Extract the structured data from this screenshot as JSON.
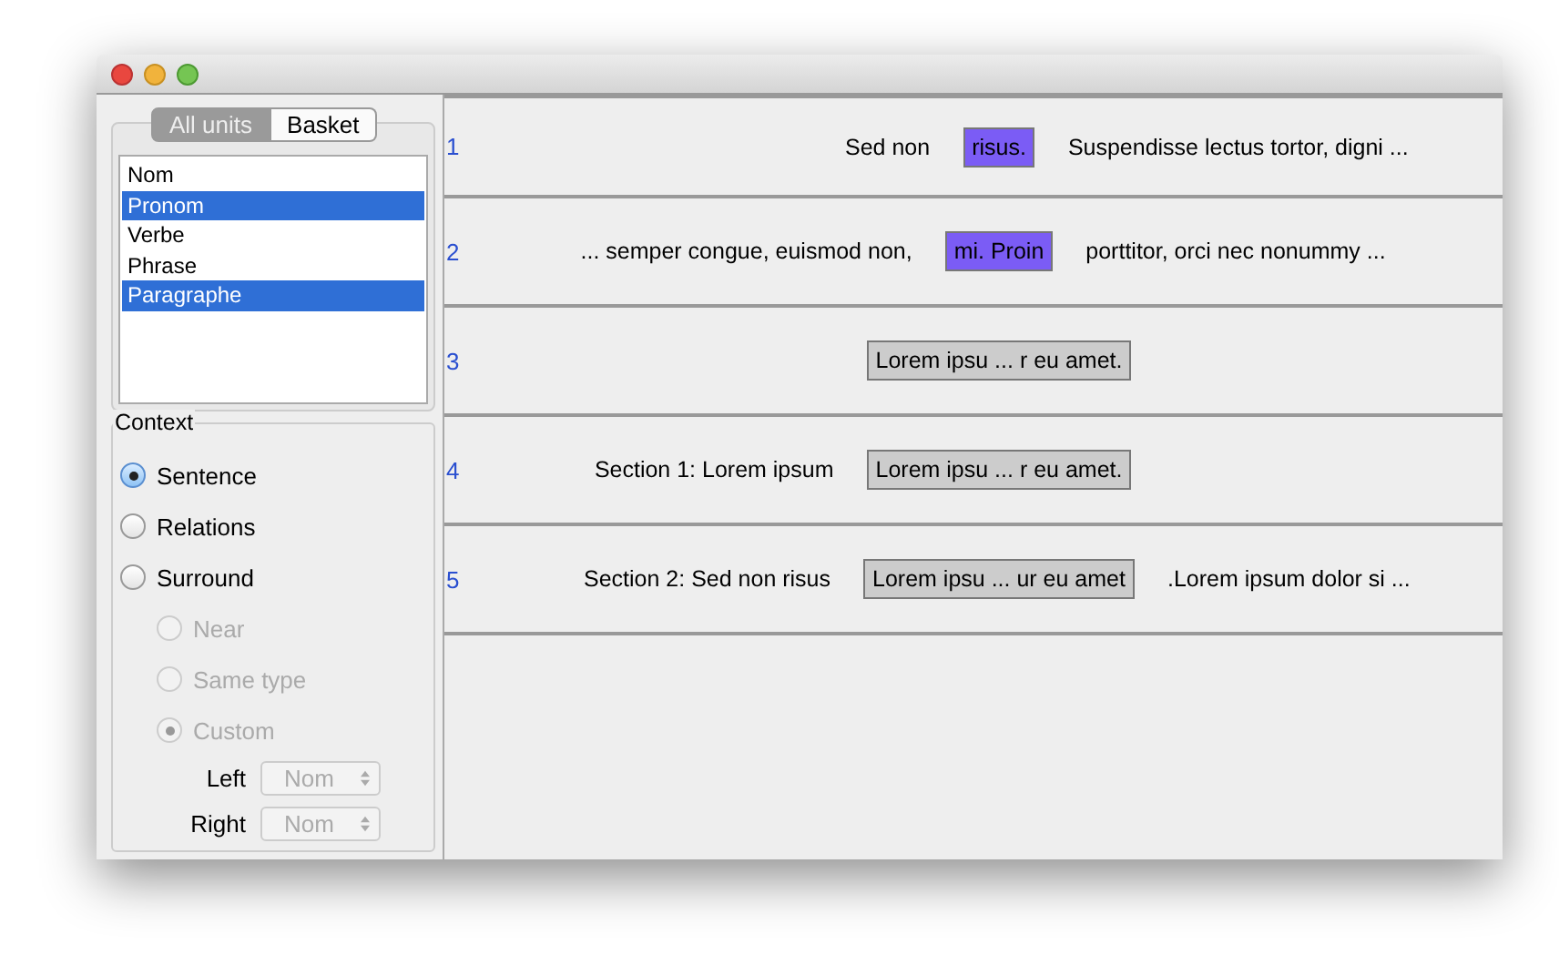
{
  "tabs": [
    {
      "label": "All units",
      "selected": true
    },
    {
      "label": "Basket",
      "selected": false
    }
  ],
  "units": [
    {
      "label": "Nom",
      "selected": false
    },
    {
      "label": "Pronom",
      "selected": true
    },
    {
      "label": "Verbe",
      "selected": false
    },
    {
      "label": "Phrase",
      "selected": false
    },
    {
      "label": "Paragraphe",
      "selected": true
    }
  ],
  "context": {
    "title": "Context",
    "options": [
      {
        "label": "Sentence",
        "selected": true,
        "disabled": false
      },
      {
        "label": "Relations",
        "selected": false,
        "disabled": false
      },
      {
        "label": "Surround",
        "selected": false,
        "disabled": false,
        "children": [
          {
            "label": "Near",
            "selected": false,
            "disabled": true
          },
          {
            "label": "Same type",
            "selected": false,
            "disabled": true
          },
          {
            "label": "Custom",
            "selected": true,
            "disabled": true
          }
        ]
      }
    ],
    "selectors": [
      {
        "label": "Left",
        "value": "Nom",
        "disabled": true
      },
      {
        "label": "Right",
        "value": "Nom",
        "disabled": true
      }
    ]
  },
  "results": [
    {
      "number": "1",
      "left": "Sed non",
      "hit": "risus.",
      "color": "#7b5cf5",
      "right": "Suspendisse lectus tortor, digni ..."
    },
    {
      "number": "2",
      "left": "... semper congue, euismod non,",
      "hit": "mi. Proin",
      "color": "#7b5cf5",
      "right": "porttitor, orci nec nonummy  ..."
    },
    {
      "number": "3",
      "hit": "Lorem ipsu ... r eu amet.",
      "color": "#cccccc"
    },
    {
      "number": "4",
      "left": "Section 1: Lorem ipsum",
      "hit": "Lorem ipsu ... r eu amet.",
      "color": "#cccccc"
    },
    {
      "number": "5",
      "left": "Section 2: Sed non risus",
      "hit": "Lorem ipsu ... ur eu amet",
      "color": "#cccccc",
      "right": ".Lorem ipsum dolor si ..."
    }
  ]
}
